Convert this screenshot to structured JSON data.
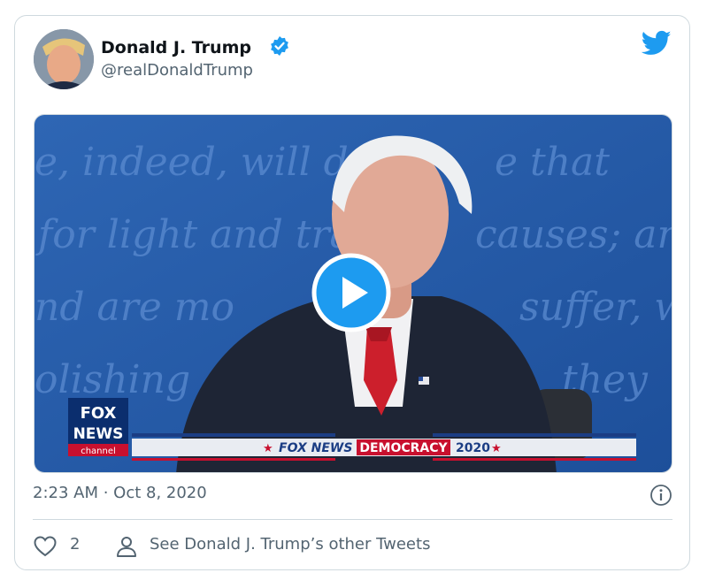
{
  "tweet": {
    "author_name": "Donald J. Trump",
    "author_handle": "@realDonaldTrump",
    "timestamp": "2:23 AM · Oct 8, 2020",
    "like_count": "2",
    "see_more_text": "See Donald J. Trump’s other Tweets"
  },
  "media": {
    "background_text": [
      "e, indeed, will d",
      "e that",
      "for light and tra",
      "causes; an",
      "nd are mo",
      "suffer, whe",
      "olishing",
      "they"
    ],
    "logo_text_1": "FOX",
    "logo_text_2": "NEWS",
    "logo_text_3": "channel",
    "banner_brand": "FOX NEWS",
    "banner_title": "DEMOCRACY",
    "banner_year": "2020"
  },
  "colors": {
    "accent": "#1d9bf0",
    "secondary_text": "#536471",
    "border": "#cfd9de",
    "banner_red": "#c8102e"
  },
  "icons": {
    "verified": "verified-badge-icon",
    "brand": "twitter-bird-icon",
    "info": "info-icon",
    "like": "heart-icon",
    "person": "person-icon",
    "play": "play-icon"
  }
}
